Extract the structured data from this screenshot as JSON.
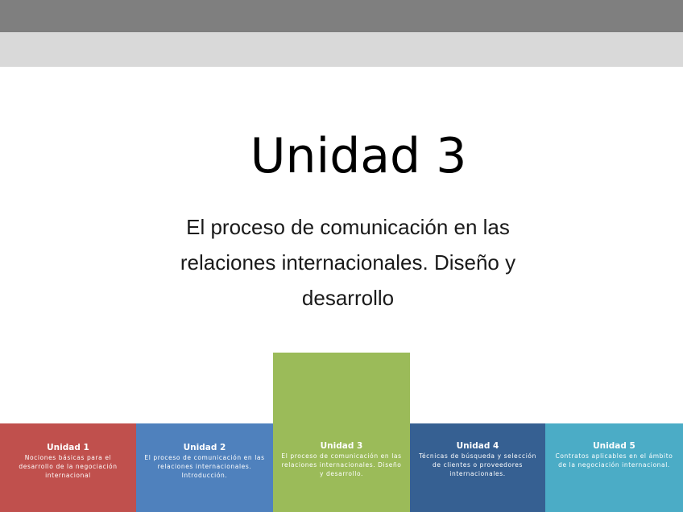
{
  "slide": {
    "title": "Unidad 3",
    "subtitle": "El proceso de comunicación en las relaciones internacionales. Diseño y desarrollo"
  },
  "units": [
    {
      "title": "Unidad 1",
      "description": "Nociones básicas para el desarrollo de la negociación internacional",
      "color": "#c0504d"
    },
    {
      "title": "Unidad 2",
      "description": "El proceso de comunicación en las relaciones internacionales. Introducción.",
      "color": "#4f81bd"
    },
    {
      "title": "Unidad 3",
      "description": "El proceso de comunicación en las relaciones internacionales. Diseño y desarrollo.",
      "color": "#9bbb59"
    },
    {
      "title": "Unidad 4",
      "description": "Técnicas de búsqueda y selección de clientes o proveedores internacionales.",
      "color": "#366092"
    },
    {
      "title": "Unidad 5",
      "description": "Contratos aplicables en el ámbito de la negociación internacional.",
      "color": "#4bacc6"
    }
  ],
  "colors": {
    "top_bar": "#7f7f7f",
    "sub_bar": "#d9d9d9",
    "background": "#ffffff"
  }
}
